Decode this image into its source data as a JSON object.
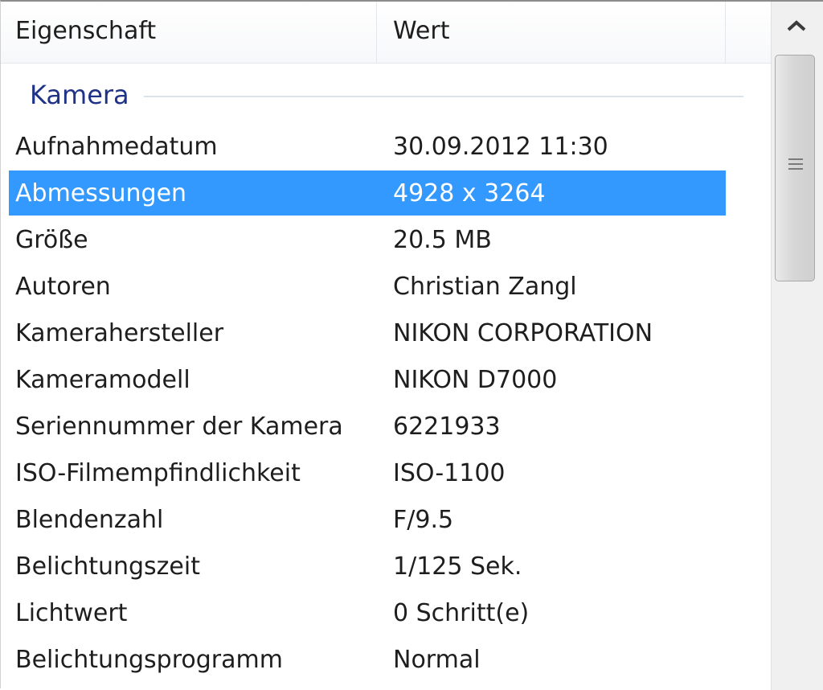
{
  "header": {
    "col_property": "Eigenschaft",
    "col_value": "Wert"
  },
  "group": {
    "label": "Kamera"
  },
  "rows": [
    {
      "property": "Aufnahmedatum",
      "value": "30.09.2012 11:30"
    },
    {
      "property": "Abmessungen",
      "value": "4928 x 3264",
      "selected": true
    },
    {
      "property": "Größe",
      "value": "20.5 MB"
    },
    {
      "property": "Autoren",
      "value": "Christian Zangl"
    },
    {
      "property": "Kamerahersteller",
      "value": "NIKON CORPORATION"
    },
    {
      "property": "Kameramodell",
      "value": "NIKON D7000"
    },
    {
      "property": "Seriennummer der Kamera",
      "value": "6221933"
    },
    {
      "property": "ISO-Filmempfindlichkeit",
      "value": "ISO-1100"
    },
    {
      "property": "Blendenzahl",
      "value": "F/9.5"
    },
    {
      "property": "Belichtungszeit",
      "value": "1/125 Sek."
    },
    {
      "property": "Lichtwert",
      "value": "0 Schritt(e)"
    },
    {
      "property": "Belichtungsprogramm",
      "value": "Normal"
    }
  ],
  "colors": {
    "selection": "#3399ff",
    "group_text": "#1e3287"
  },
  "icons": {
    "scroll_up": "chevron-up-icon",
    "thumb_grip": "grip-lines-icon"
  }
}
